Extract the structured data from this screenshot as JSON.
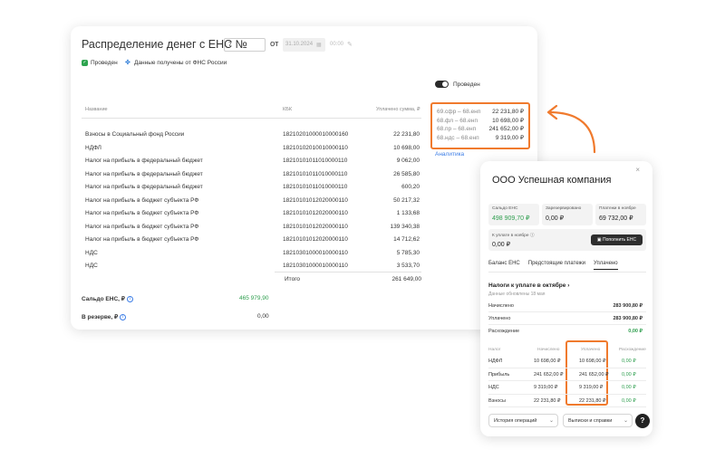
{
  "main": {
    "title": "Распределение денег с ЕНС №",
    "doc_number": "7",
    "ot_label": "от",
    "date": "31.10.2024",
    "time": "00:00",
    "badge_done": "Проведен",
    "badge_fns": "Данные получены от ФНС России",
    "toggle_label": "Проведен",
    "col_name": "Название",
    "col_kbk": "КБК",
    "col_sum": "Уплачено сумма, ₽",
    "rows": [
      {
        "name": "Взносы в Социальный фонд России",
        "kbk": "18210201000010000160",
        "sum": "22 231,80"
      },
      {
        "name": "НДФЛ",
        "kbk": "18210102010010000110",
        "sum": "10 698,00"
      },
      {
        "name": "Налог на прибыль в федеральный бюджет",
        "kbk": "18210101011010000110",
        "sum": "9 062,00"
      },
      {
        "name": "Налог на прибыль в федеральный бюджет",
        "kbk": "18210101011010000110",
        "sum": "26 585,80"
      },
      {
        "name": "Налог на прибыль в федеральный бюджет",
        "kbk": "18210101011010000110",
        "sum": "600,20"
      },
      {
        "name": "Налог на прибыль в бюджет субъекта РФ",
        "kbk": "18210101012020000110",
        "sum": "50 217,32"
      },
      {
        "name": "Налог на прибыль в бюджет субъекта РФ",
        "kbk": "18210101012020000110",
        "sum": "1 133,68"
      },
      {
        "name": "Налог на прибыль в бюджет субъекта РФ",
        "kbk": "18210101012020000110",
        "sum": "139 340,38"
      },
      {
        "name": "Налог на прибыль в бюджет субъекта РФ",
        "kbk": "18210101012020000110",
        "sum": "14 712,62"
      },
      {
        "name": "НДС",
        "kbk": "18210301000010000110",
        "sum": "5 785,30"
      },
      {
        "name": "НДС",
        "kbk": "18210301000010000110",
        "sum": "3 533,70"
      }
    ],
    "total_label": "Итого",
    "total_value": "261 649,00",
    "saldo_label": "Сальдо ЕНС, ₽",
    "saldo_value": "465 979,90",
    "reserve_label": "В резерве, ₽",
    "reserve_value": "0,00",
    "distribution": [
      {
        "key": "69.сфр – 68.енп",
        "value": "22 231,80 ₽"
      },
      {
        "key": "68.фл – 68.енп",
        "value": "10 698,00 ₽"
      },
      {
        "key": "68.пр – 68.енп",
        "value": "241 652,00 ₽"
      },
      {
        "key": "68.ндс – 68.енп",
        "value": "9 319,00 ₽"
      }
    ],
    "analytics_link": "Аналитика"
  },
  "side": {
    "close_icon": "×",
    "title": "ООО Успешная компания",
    "kpis": [
      {
        "label": "Сальдо ЕНС",
        "value": "498 909,70 ₽",
        "color": "green"
      },
      {
        "label": "Зарезервировано",
        "value": "0,00 ₽",
        "color": "default"
      },
      {
        "label": "Платежи в ноябре",
        "value": "69 732,00 ₽",
        "color": "default"
      }
    ],
    "pay_label": "К уплате в ноябре",
    "pay_value": "0,00 ₽",
    "pay_button": "Пополнить ЕНС",
    "tabs": [
      "Баланс ЕНС",
      "Предстоящие платежи",
      "Уплачено"
    ],
    "section_title": "Налоги к уплате в октябре",
    "section_sub": "Данные обновлены 18 мая",
    "summary": [
      {
        "label": "Начислено",
        "value": "283 900,80 ₽"
      },
      {
        "label": "Уплачено",
        "value": "283 900,80 ₽"
      },
      {
        "label": "Расхождение",
        "value": "0,00 ₽"
      }
    ],
    "table_headers": [
      "Налог",
      "Начислено",
      "Уплачено",
      "Расхождение"
    ],
    "table_rows": [
      {
        "tax": "НДФЛ",
        "accrued": "10 698,00 ₽",
        "paid": "10 698,00 ₽",
        "diff": "0,00 ₽"
      },
      {
        "tax": "Прибыль",
        "accrued": "241 652,00 ₽",
        "paid": "241 652,00 ₽",
        "diff": "0,00 ₽"
      },
      {
        "tax": "НДС",
        "accrued": "9 319,00 ₽",
        "paid": "9 319,00 ₽",
        "diff": "0,00 ₽"
      },
      {
        "tax": "Взносы",
        "accrued": "22 231,80 ₽",
        "paid": "22 231,80 ₽",
        "diff": "0,00 ₽"
      }
    ],
    "history_select": "История операций",
    "statements_select": "Выписки и справки",
    "help_icon": "?"
  },
  "colors": {
    "accent": "#f07a2d",
    "green": "#2e9e4e",
    "link": "#3d7ee6",
    "dark": "#2e2e2e"
  }
}
